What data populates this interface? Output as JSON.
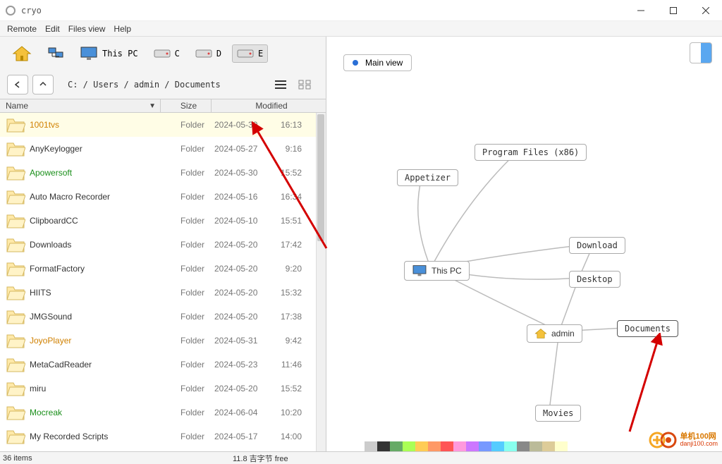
{
  "window": {
    "title": "cryo"
  },
  "menubar": [
    "Remote",
    "Edit",
    "Files view",
    "Help"
  ],
  "drives": {
    "thispc": "This PC",
    "c": "C",
    "d": "D",
    "e": "E"
  },
  "breadcrumb": "C: / Users / admin / Documents",
  "columns": {
    "name": "Name",
    "size": "Size",
    "modified": "Modified"
  },
  "files": [
    {
      "name": "1001tvs",
      "type": "Folder",
      "date": "2024-05-30",
      "time": "16:13",
      "cls": "orange"
    },
    {
      "name": "AnyKeylogger",
      "type": "Folder",
      "date": "2024-05-27",
      "time": "9:16",
      "cls": ""
    },
    {
      "name": "Apowersoft",
      "type": "Folder",
      "date": "2024-05-30",
      "time": "15:52",
      "cls": "green"
    },
    {
      "name": "Auto Macro Recorder",
      "type": "Folder",
      "date": "2024-05-16",
      "time": "16:34",
      "cls": ""
    },
    {
      "name": "ClipboardCC",
      "type": "Folder",
      "date": "2024-05-10",
      "time": "15:51",
      "cls": ""
    },
    {
      "name": "Downloads",
      "type": "Folder",
      "date": "2024-05-20",
      "time": "17:42",
      "cls": ""
    },
    {
      "name": "FormatFactory",
      "type": "Folder",
      "date": "2024-05-20",
      "time": "9:20",
      "cls": ""
    },
    {
      "name": "HIITS",
      "type": "Folder",
      "date": "2024-05-20",
      "time": "15:32",
      "cls": ""
    },
    {
      "name": "JMGSound",
      "type": "Folder",
      "date": "2024-05-20",
      "time": "17:38",
      "cls": ""
    },
    {
      "name": "JoyoPlayer",
      "type": "Folder",
      "date": "2024-05-31",
      "time": "9:42",
      "cls": "orange"
    },
    {
      "name": "MetaCadReader",
      "type": "Folder",
      "date": "2024-05-23",
      "time": "11:46",
      "cls": ""
    },
    {
      "name": "miru",
      "type": "Folder",
      "date": "2024-05-20",
      "time": "15:52",
      "cls": ""
    },
    {
      "name": "Mocreak",
      "type": "Folder",
      "date": "2024-06-04",
      "time": "10:20",
      "cls": "green"
    },
    {
      "name": "My Recorded Scripts",
      "type": "Folder",
      "date": "2024-05-17",
      "time": "14:00",
      "cls": ""
    }
  ],
  "statusbar": {
    "items": "36 items",
    "free": "11.8 吉字节 free"
  },
  "rightpane": {
    "mainview": "Main view",
    "nodes": {
      "appetizer": "Appetizer",
      "programfiles": "Program Files (x86)",
      "thispc": "This PC",
      "download": "Download",
      "desktop": "Desktop",
      "admin": "admin",
      "documents": "Documents",
      "movies": "Movies"
    }
  },
  "watermark": {
    "line1": "单机100网",
    "line2": "danji100.com"
  },
  "colorstrip": [
    "#fff",
    "#ccc",
    "#333",
    "#6a6",
    "#af5",
    "#fc5",
    "#f96",
    "#f55",
    "#f9d",
    "#c7f",
    "#79f",
    "#5cf",
    "#8fe",
    "#888",
    "#bb9",
    "#dc9",
    "#ffc"
  ]
}
